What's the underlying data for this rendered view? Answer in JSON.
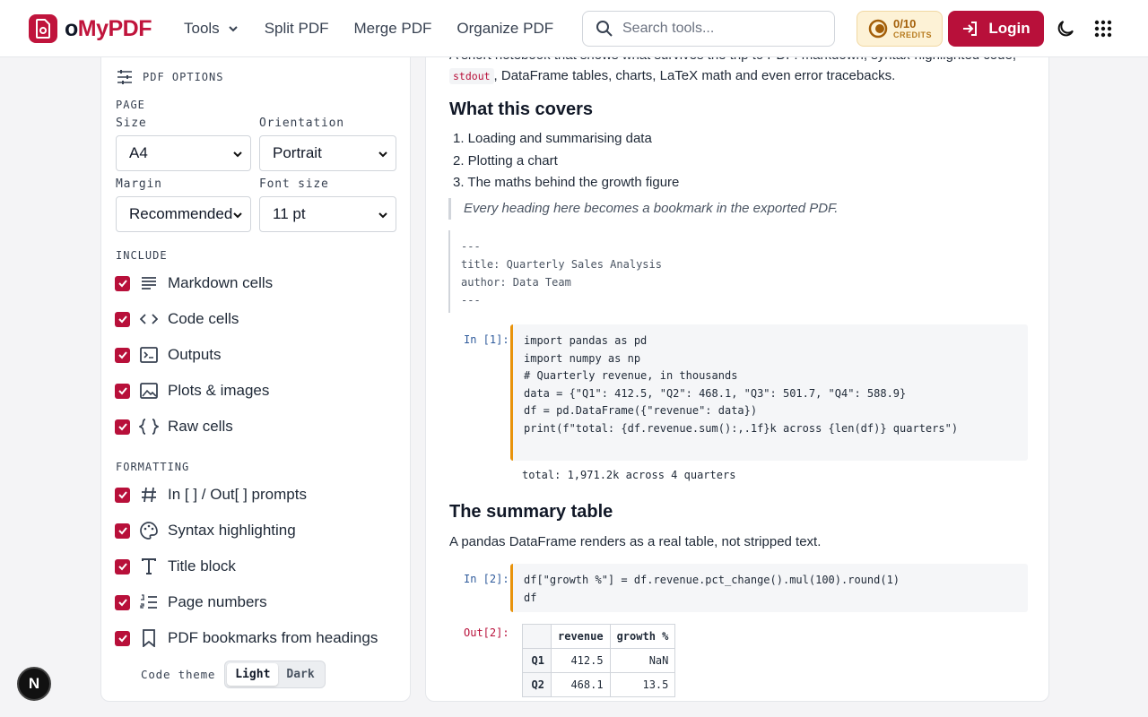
{
  "header": {
    "logo_text_a": "o",
    "logo_text_b": "MyPDF",
    "nav": [
      {
        "label": "Tools"
      },
      {
        "label": "Split PDF"
      },
      {
        "label": "Merge PDF"
      },
      {
        "label": "Organize PDF"
      }
    ],
    "search_placeholder": "Search tools...",
    "credits_count": "0/10",
    "credits_label": "CREDITS",
    "login_label": "Login"
  },
  "options": {
    "title": "PDF OPTIONS",
    "page_section": "PAGE",
    "size_label": "Size",
    "size_value": "A4",
    "orientation_label": "Orientation",
    "orientation_value": "Portrait",
    "margin_label": "Margin",
    "margin_value": "Recommended",
    "font_size_label": "Font size",
    "font_size_value": "11 pt",
    "include_section": "INCLUDE",
    "include": [
      {
        "label": "Markdown cells",
        "checked": true,
        "icon": "lines-icon"
      },
      {
        "label": "Code cells",
        "checked": true,
        "icon": "code-icon"
      },
      {
        "label": "Outputs",
        "checked": true,
        "icon": "terminal-icon"
      },
      {
        "label": "Plots & images",
        "checked": true,
        "icon": "image-icon"
      },
      {
        "label": "Raw cells",
        "checked": true,
        "icon": "braces-icon"
      }
    ],
    "formatting_section": "FORMATTING",
    "formatting": [
      {
        "label": "In [ ] / Out[ ] prompts",
        "checked": true,
        "icon": "hash-icon"
      },
      {
        "label": "Syntax highlighting",
        "checked": true,
        "icon": "palette-icon"
      },
      {
        "label": "Title block",
        "checked": true,
        "icon": "type-icon"
      },
      {
        "label": "Page numbers",
        "checked": true,
        "icon": "numbered-list-icon"
      },
      {
        "label": "PDF bookmarks from headings",
        "checked": true,
        "icon": "bookmark-icon"
      }
    ],
    "code_theme_label": "Code theme",
    "code_theme_light": "Light",
    "code_theme_dark": "Dark",
    "code_theme_selected": "Light"
  },
  "preview": {
    "intro_line1": "A short notebook that shows what survives the trip to PDF: markdown, syntax-highlighted code,",
    "intro_code": "stdout",
    "intro_line2": ", DataFrame tables, charts, LaTeX math and even error tracebacks.",
    "heading_covers": "What this covers",
    "list": [
      "1. Loading and summarising data",
      "2. Plotting a chart",
      "3. The maths behind the growth figure"
    ],
    "quote": "Every heading here becomes a bookmark in the exported PDF.",
    "raw": [
      "---",
      "title: Quarterly Sales Analysis",
      "author: Data Team",
      "---"
    ],
    "in1_prompt": "In [1]:",
    "code1": [
      "import pandas as pd",
      "import numpy as np",
      "",
      "# Quarterly revenue, in thousands",
      "data = {\"Q1\": 412.5, \"Q2\": 468.1, \"Q3\": 501.7, \"Q4\": 588.9}",
      "df = pd.DataFrame({\"revenue\": data})",
      "print(f\"total: {df.revenue.sum():,.1f}k across {len(df)} quarters\")"
    ],
    "out1_text": "total: 1,971.2k across 4 quarters",
    "heading_summary": "The summary table",
    "summary_text": "A pandas DataFrame renders as a real table, not stripped text.",
    "in2_prompt": "In [2]:",
    "code2": [
      "df[\"growth %\"] = df.revenue.pct_change().mul(100).round(1)",
      "df"
    ],
    "out2_prompt": "Out[2]:",
    "table": {
      "columns": [
        "revenue",
        "growth %"
      ],
      "rows": [
        {
          "index": "Q1",
          "revenue": "412.5",
          "growth": "NaN"
        },
        {
          "index": "Q2",
          "revenue": "468.1",
          "growth": "13.5"
        }
      ]
    }
  },
  "floating_button": "N",
  "colors": {
    "brand": "#b8103a",
    "code_accent": "#e8930c",
    "prompt_in": "#2f5b9c"
  }
}
